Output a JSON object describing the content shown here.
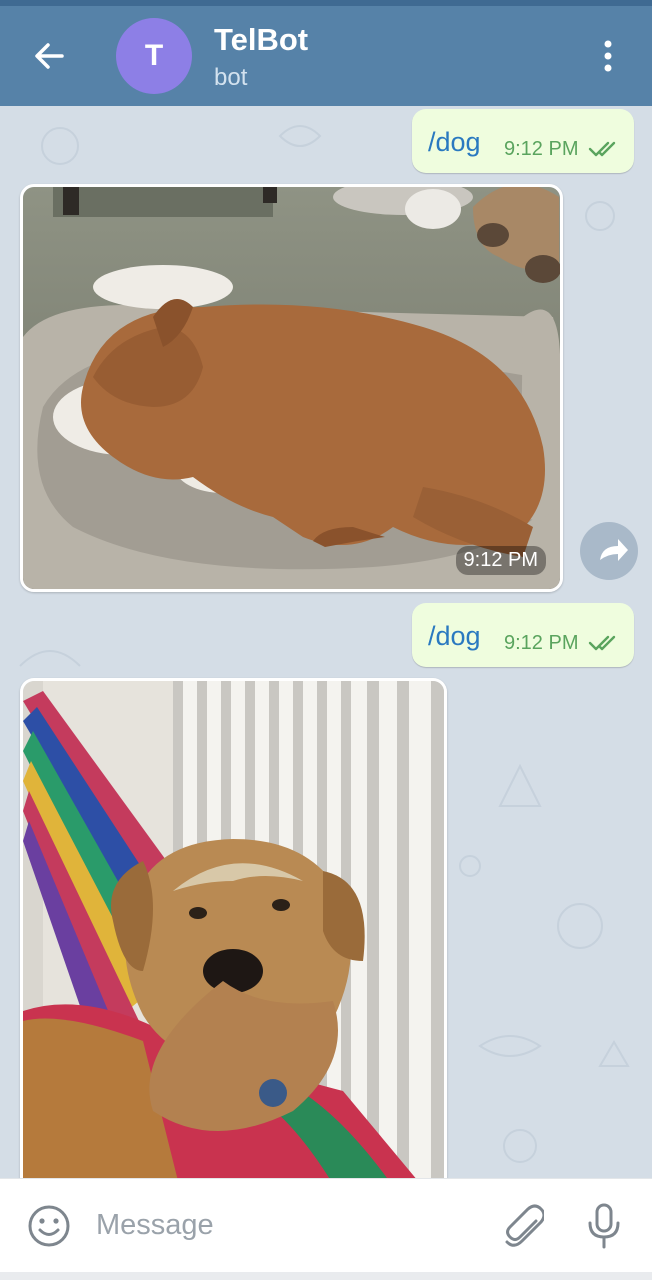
{
  "header": {
    "title": "TelBot",
    "subtitle": "bot",
    "avatar_letter": "T",
    "avatar_color": "#8d7fe6",
    "bar_color": "#5682a8"
  },
  "messages": [
    {
      "type": "outgoing",
      "text": "/dog",
      "time": "9:12 PM",
      "status": "read"
    },
    {
      "type": "photo",
      "time": "9:12 PM"
    },
    {
      "type": "outgoing",
      "text": "/dog",
      "time": "9:12 PM",
      "status": "read"
    },
    {
      "type": "photo"
    }
  ],
  "input": {
    "placeholder": "Message"
  },
  "icons": [
    "back-arrow-icon",
    "more-vert-icon",
    "share-icon",
    "emoji-icon",
    "attach-icon",
    "mic-icon"
  ],
  "colors": {
    "outgoing_bubble": "#effdde",
    "command_text": "#2a79c0",
    "time_text": "#5aa45e",
    "chat_background": "#d4dde6"
  }
}
